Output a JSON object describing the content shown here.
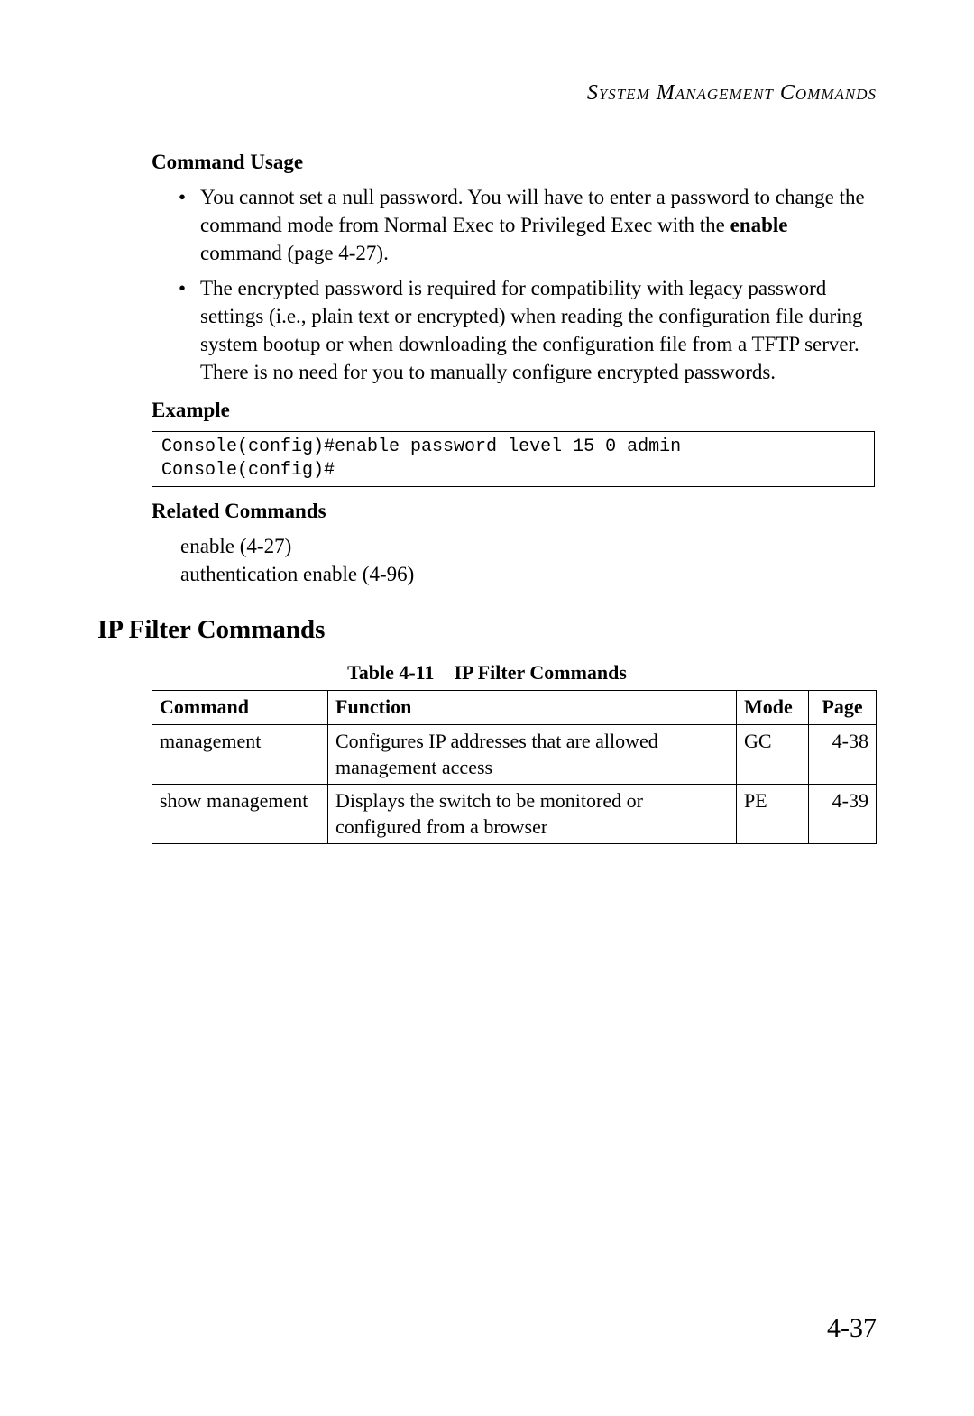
{
  "header": {
    "title": "System Management Commands"
  },
  "sections": {
    "command_usage": {
      "heading": "Command Usage",
      "bullets": [
        {
          "pre": "You cannot set a null password. You will have to enter a password to change the command mode from Normal Exec to Privileged Exec with the ",
          "bold": "enable",
          "post": " command (page 4-27)."
        },
        {
          "pre": "The encrypted password is required for compatibility with legacy password settings (i.e., plain text or encrypted) when reading the configuration file during system bootup or when downloading the configuration file from a TFTP server. There is no need for you to manually configure encrypted passwords.",
          "bold": "",
          "post": ""
        }
      ]
    },
    "example": {
      "heading": "Example",
      "code": "Console(config)#enable password level 15 0 admin\nConsole(config)#"
    },
    "related": {
      "heading": "Related Commands",
      "items": [
        "enable (4-27)",
        "authentication enable (4-96)"
      ]
    },
    "ipfilter": {
      "heading": "IP Filter Commands",
      "caption_label": "Table 4-11",
      "caption_title": "IP Filter Commands",
      "columns": {
        "command": "Command",
        "function": "Function",
        "mode": "Mode",
        "page": "Page"
      },
      "rows": [
        {
          "command": "management",
          "function": "Configures IP addresses that are allowed management access",
          "mode": "GC",
          "page": "4-38"
        },
        {
          "command": "show management",
          "function": "Displays the switch to be monitored or configured from a browser",
          "mode": "PE",
          "page": "4-39"
        }
      ]
    }
  },
  "page_number": "4-37"
}
